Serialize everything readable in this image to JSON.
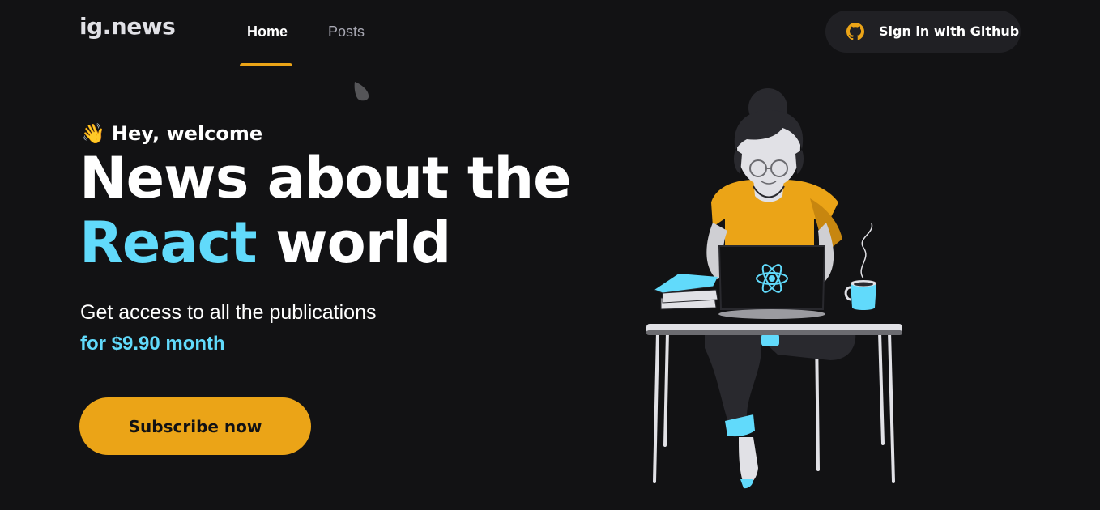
{
  "header": {
    "logo": "ig.news",
    "nav": [
      {
        "label": "Home",
        "active": true
      },
      {
        "label": "Posts",
        "active": false
      }
    ],
    "signin_label": "Sign in with Github",
    "signin_icon": "github-icon"
  },
  "hero": {
    "welcome_emoji": "👋",
    "welcome_text": "Hey, welcome",
    "headline_line1": "News about the",
    "headline_accent": "React",
    "headline_rest": " world",
    "subtitle": "Get access to all the publications",
    "price": "for $9.90 month",
    "subscribe_label": "Subscribe now"
  },
  "colors": {
    "background": "#121214",
    "accent_yellow": "#eba417",
    "accent_cyan": "#61dafb",
    "surface": "#202024"
  }
}
